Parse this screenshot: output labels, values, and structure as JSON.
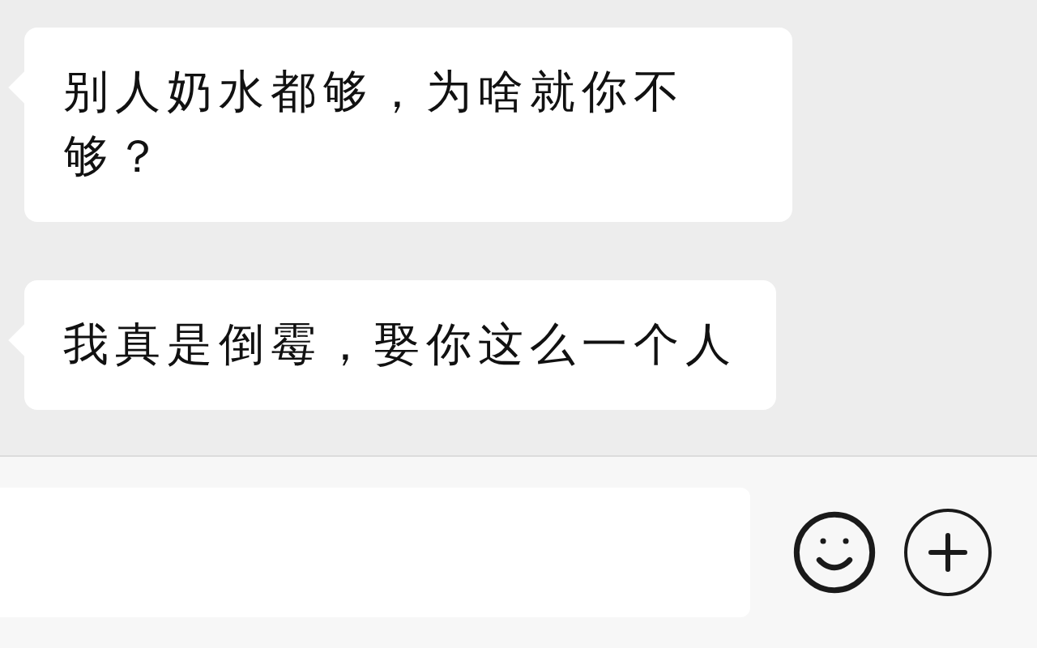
{
  "messages": [
    {
      "text": "别人奶水都够，为啥就你不够？"
    },
    {
      "text": "我真是倒霉，娶你这么一个人"
    }
  ]
}
